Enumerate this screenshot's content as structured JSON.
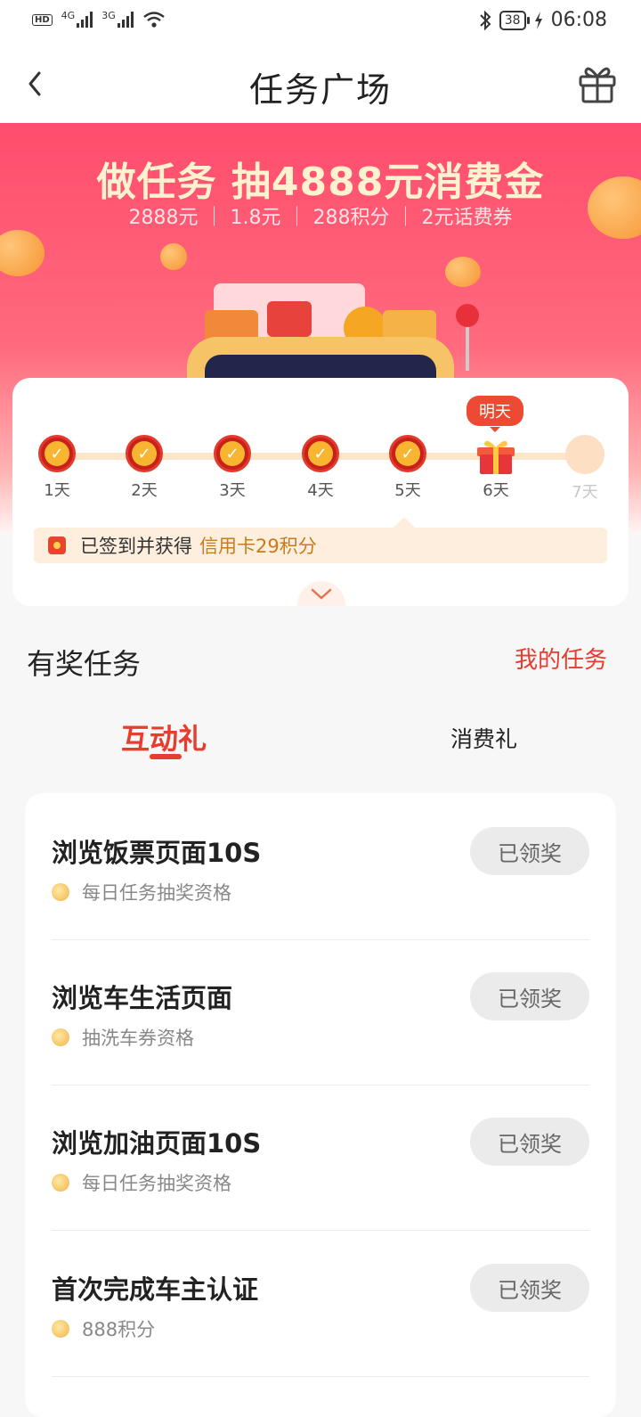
{
  "status_bar": {
    "net1": "4G",
    "net2": "3G",
    "battery": "38",
    "time": "06:08"
  },
  "nav": {
    "title": "任务广场"
  },
  "banner": {
    "title": "做任务 抽4888元消费金",
    "subtitle": "2888元 ｜ 1.8元 ｜ 288积分 ｜ 2元话费券"
  },
  "signin": {
    "days": [
      "1天",
      "2天",
      "3天",
      "4天",
      "5天",
      "6天",
      "7天"
    ],
    "tomorrow_label": "明天",
    "notice_prefix": "已签到并获得",
    "notice_reward": "信用卡29积分"
  },
  "section": {
    "title": "有奖任务",
    "my_tasks": "我的任务"
  },
  "tabs": [
    "互动礼",
    "消费礼"
  ],
  "tasks": [
    {
      "title": "浏览饭票页面10S",
      "reward": "每日任务抽奖资格",
      "status": "已领奖"
    },
    {
      "title": "浏览车生活页面",
      "reward": "抽洗车券资格",
      "status": "已领奖"
    },
    {
      "title": "浏览加油页面10S",
      "reward": "每日任务抽奖资格",
      "status": "已领奖"
    },
    {
      "title": "首次完成车主认证",
      "reward": "888积分",
      "status": "已领奖"
    }
  ],
  "colors": {
    "accent": "#e63d2e",
    "banner": "#ff4d6d",
    "gold": "#f7b531"
  }
}
